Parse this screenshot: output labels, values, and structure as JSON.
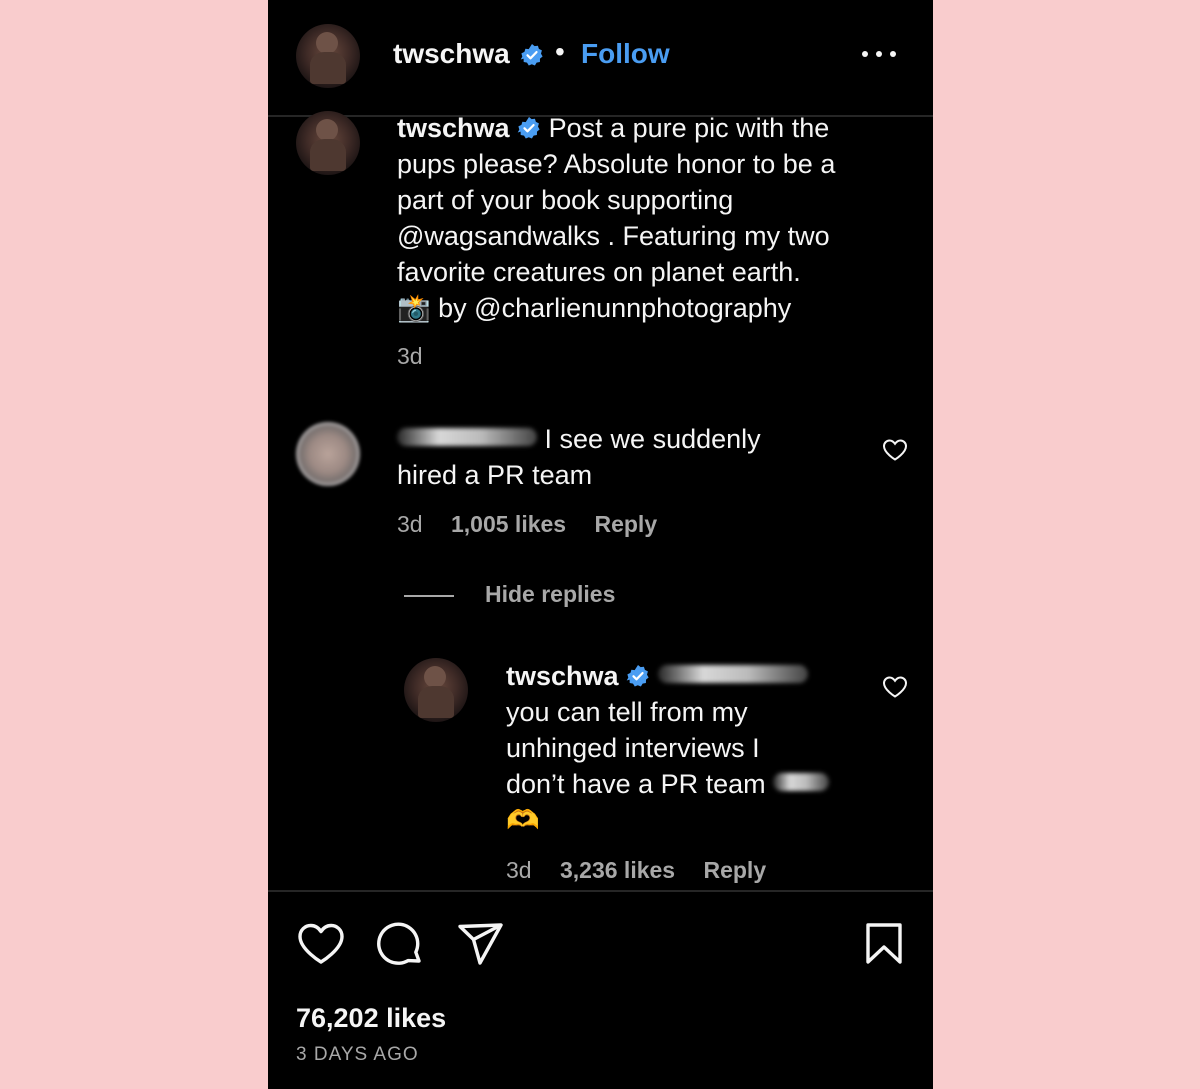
{
  "header": {
    "username": "twschwa",
    "separator": "•",
    "follow_label": "Follow",
    "more_icon": "more-horizontal-icon"
  },
  "caption": {
    "username": "twschwa",
    "line1": "Post a pure pic with the",
    "line2": "pups please? Absolute honor to be a",
    "line3": "part of your book supporting",
    "line4": "@wagsandwalks . Featuring my two",
    "line5": "favorite creatures on planet earth.",
    "camera_emoji": "📸",
    "line6": "by @charlienunnphotography",
    "time": "3d"
  },
  "comment": {
    "line1": "I see we suddenly",
    "line2": "hired a PR team",
    "time": "3d",
    "likes": "1,005 likes",
    "reply_label": "Reply"
  },
  "hide_replies_label": "Hide replies",
  "reply": {
    "username": "twschwa",
    "line1": "you can tell from my",
    "line2": "unhinged interviews I",
    "line3": "don’t have a PR team",
    "emoji": "🫶",
    "time": "3d",
    "likes": "3,236 likes",
    "reply_label": "Reply"
  },
  "footer": {
    "likes": "76,202 likes",
    "date": "3 DAYS AGO"
  },
  "colors": {
    "background": "#f9cccd",
    "panel": "#000000",
    "text": "#f5f5f5",
    "muted": "#a8a8a8",
    "link": "#4a9df2",
    "verified": "#4a9df2"
  }
}
